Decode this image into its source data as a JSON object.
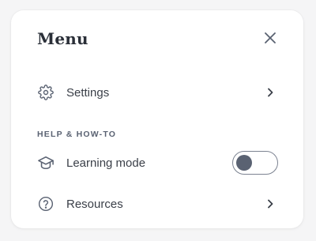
{
  "menu": {
    "title": "Menu",
    "close_icon": "close-icon",
    "settings": {
      "label": "Settings",
      "icon": "gear-icon",
      "trailing_icon": "chevron-right-icon"
    },
    "section_header": "HELP & HOW-TO",
    "learning_mode": {
      "label": "Learning mode",
      "icon": "graduation-cap-icon",
      "enabled": false
    },
    "resources": {
      "label": "Resources",
      "icon": "question-circle-icon",
      "trailing_icon": "chevron-right-icon"
    }
  },
  "colors": {
    "text": "#3a3f48",
    "icon": "#5a6272",
    "card": "#ffffff",
    "background": "#f5f5f6"
  }
}
